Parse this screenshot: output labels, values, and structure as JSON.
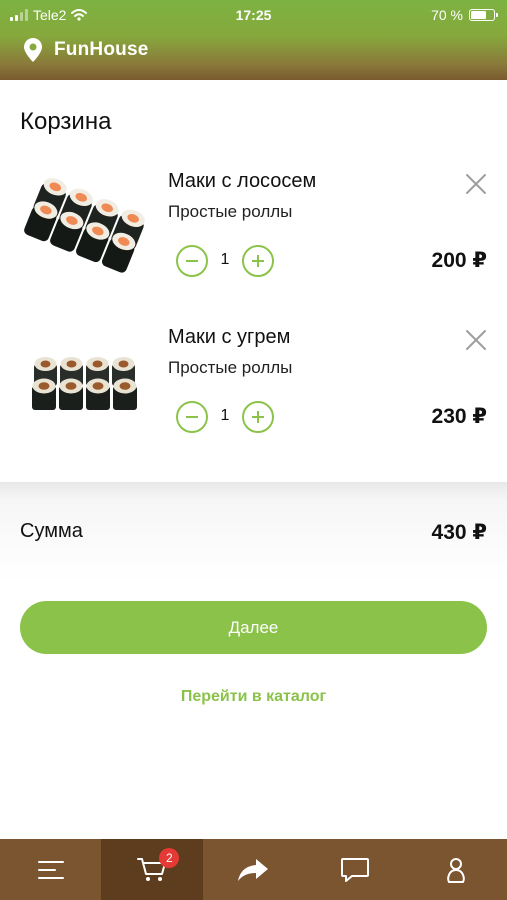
{
  "status_bar": {
    "carrier": "Tele2",
    "time": "17:25",
    "battery": "70 %"
  },
  "header": {
    "brand": "FunHouse"
  },
  "page": {
    "title": "Корзина"
  },
  "cart": {
    "items": [
      {
        "name": "Маки с лососем",
        "category": "Простые роллы",
        "quantity": "1",
        "price": "200 ₽"
      },
      {
        "name": "Маки с угрем",
        "category": "Простые роллы",
        "quantity": "1",
        "price": "230 ₽"
      }
    ]
  },
  "summary": {
    "label": "Сумма",
    "total": "430 ₽"
  },
  "actions": {
    "next_label": "Далее",
    "catalog_link": "Перейти в каталог"
  },
  "bottom_nav": {
    "items": [
      {
        "icon": "menu-icon"
      },
      {
        "icon": "cart-icon",
        "badge": "2",
        "active": true
      },
      {
        "icon": "share-icon"
      },
      {
        "icon": "chat-icon"
      },
      {
        "icon": "profile-icon"
      }
    ]
  },
  "colors": {
    "accent": "#8bc34a",
    "nav_bg": "#7b5430",
    "nav_active": "#5e3c1e",
    "badge": "#e53935"
  }
}
